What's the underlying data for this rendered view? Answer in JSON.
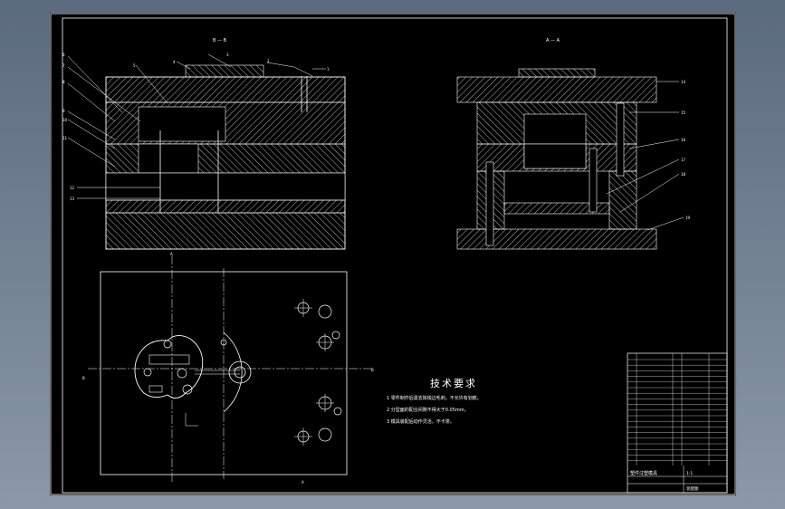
{
  "view_labels": {
    "section_left": "B — B",
    "section_right": "A — A",
    "plan_left_mark": "B",
    "plan_right_mark": "B",
    "plan_top_mark": "A",
    "plan_bottom_mark": "A"
  },
  "part_numbers": [
    "1",
    "2",
    "3",
    "4",
    "5",
    "6",
    "7",
    "8",
    "9",
    "10",
    "11",
    "12",
    "13",
    "14",
    "15",
    "16",
    "17",
    "18",
    "19"
  ],
  "technical_requirements": {
    "title": "技术要求",
    "items": [
      "1  零件制作后需去除锐边毛刺，不允许有划痕。",
      "2  分型面的配合间隙不得大于0.05mm。",
      "3  模具装配后动作灵活，不卡滞。"
    ]
  },
  "title_block": {
    "title": "塑件注塑模具",
    "scale": "1:1",
    "sheet": "装配图"
  },
  "colors": {
    "background": "#000000",
    "line": "#ffffff",
    "frame_outer": "#5b6b7e"
  }
}
